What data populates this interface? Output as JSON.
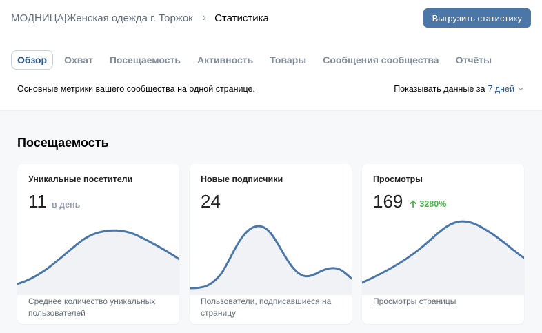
{
  "header": {
    "community": "МОДНИЦА|Женская одежда г. Торжок",
    "separator": "›",
    "current": "Статистика",
    "export_label": "Выгрузить статистику"
  },
  "tabs": [
    {
      "label": "Обзор",
      "active": true
    },
    {
      "label": "Охват"
    },
    {
      "label": "Посещаемость"
    },
    {
      "label": "Активность"
    },
    {
      "label": "Товары"
    },
    {
      "label": "Сообщения сообщества"
    },
    {
      "label": "Отчёты"
    }
  ],
  "subline": "Основные метрики вашего сообщества на одной странице.",
  "period": {
    "label": "Показывать данные за",
    "value": "7 дней"
  },
  "section_title": "Посещаемость",
  "cards": [
    {
      "title": "Уникальные посетители",
      "value": "11",
      "unit": "в день",
      "description": "Среднее количество уникальных пользователей"
    },
    {
      "title": "Новые подписчики",
      "value": "24",
      "description": "Пользователи, подписавшиеся на страницу"
    },
    {
      "title": "Просмотры",
      "value": "169",
      "delta": "3280%",
      "description": "Просмотры страницы"
    }
  ],
  "colors": {
    "accent": "#4a76a8",
    "link": "#2a5885",
    "positive": "#4bb34b",
    "line": "#4a76a8",
    "area": "#f0f2f5"
  }
}
